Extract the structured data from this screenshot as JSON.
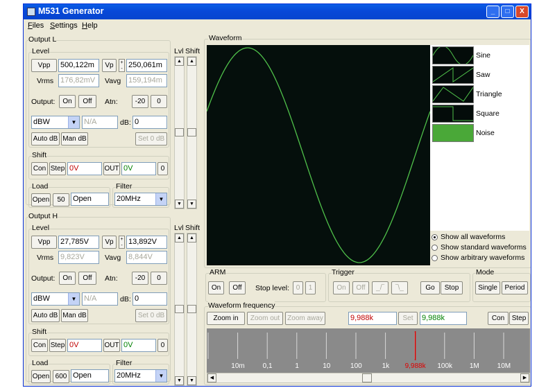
{
  "window": {
    "title": "M531 Generator",
    "min_glyph": "_",
    "max_glyph": "□",
    "close_glyph": "X"
  },
  "menu": [
    {
      "label": "Files",
      "u": "F",
      "rest": "iles"
    },
    {
      "label": "Settings",
      "u": "S",
      "rest": "ettings"
    },
    {
      "label": "Help",
      "u": "H",
      "rest": "elp"
    }
  ],
  "output_l": {
    "group": "Output L",
    "level": "Level",
    "vpp_label": "Vpp",
    "vpp": "500,122m",
    "vp_label": "Vp",
    "vp": "250,061m",
    "vrms_label": "Vrms",
    "vrms": "176,82mV",
    "vavg_label": "Vavg",
    "vavg": "159,194m",
    "output_label": "Output:",
    "on": "On",
    "off": "Off",
    "atn_label": "Atn:",
    "atn_value": "-20",
    "atn_zero": "0",
    "unit": "dBW",
    "na": "N/A",
    "db_label": "dB:",
    "db_value": "0",
    "auto_db": "Auto dB",
    "man_db": "Man dB",
    "set_0db": "Set 0 dB",
    "shift": "Shift",
    "con": "Con",
    "step": "Step",
    "shift_value": "0V",
    "out_label": "OUT",
    "out_value": "0V",
    "zero": "0",
    "load": "Load",
    "open_btn": "Open",
    "load_value": "50",
    "load_field": "Open",
    "filter": "Filter",
    "filter_value": "20MHz",
    "lvl": "Lvl",
    "shift_col": "Shift"
  },
  "output_h": {
    "group": "Output H",
    "level": "Level",
    "vpp_label": "Vpp",
    "vpp": "27,785V",
    "vp_label": "Vp",
    "vp": "13,892V",
    "vrms_label": "Vrms",
    "vrms": "9,823V",
    "vavg_label": "Vavg",
    "vavg": "8,844V",
    "output_label": "Output:",
    "on": "On",
    "off": "Off",
    "atn_label": "Atn:",
    "atn_value": "-20",
    "atn_zero": "0",
    "unit": "dBW",
    "na": "N/A",
    "db_label": "dB:",
    "db_value": "0",
    "auto_db": "Auto dB",
    "man_db": "Man dB",
    "set_0db": "Set 0 dB",
    "shift": "Shift",
    "con": "Con",
    "step": "Step",
    "shift_value": "0V",
    "out_label": "OUT",
    "out_value": "0V",
    "zero": "0",
    "load": "Load",
    "open_btn": "Open",
    "load_value": "600",
    "load_field": "Open",
    "filter": "Filter",
    "filter_value": "20MHz",
    "lvl": "Lvl",
    "shift_col": "Shift"
  },
  "waveform": {
    "group": "Waveform",
    "trace_color": "#4fc04a",
    "thumbs": [
      "Sine",
      "Saw",
      "Triangle",
      "Square",
      "Noise"
    ],
    "show_options": [
      "Show all waveforms",
      "Show standard waveforms",
      "Show arbitrary waveforms"
    ],
    "show_selected": 0
  },
  "arm": {
    "group": "ARM",
    "on": "On",
    "off": "Off",
    "stop_level": "Stop level:",
    "zero": "0",
    "one": "1"
  },
  "trigger": {
    "group": "Trigger",
    "on": "On",
    "off": "Off",
    "rise": "_/‾",
    "fall": "‾\\_",
    "go": "Go",
    "stop": "Stop"
  },
  "mode": {
    "group": "Mode",
    "single": "Single",
    "period": "Period"
  },
  "frequency": {
    "group": "Waveform frequency",
    "zoom_in": "Zoom in",
    "zoom_out": "Zoom out",
    "zoom_away": "Zoom away",
    "value": "9,988k",
    "set": "Set",
    "value2": "9,988k",
    "con": "Con",
    "step": "Step",
    "ticks": [
      "10m",
      "0,1",
      "1",
      "10",
      "100",
      "1k",
      "9,988k",
      "100k",
      "1M",
      "10M"
    ],
    "marker_color": "#e00000"
  }
}
